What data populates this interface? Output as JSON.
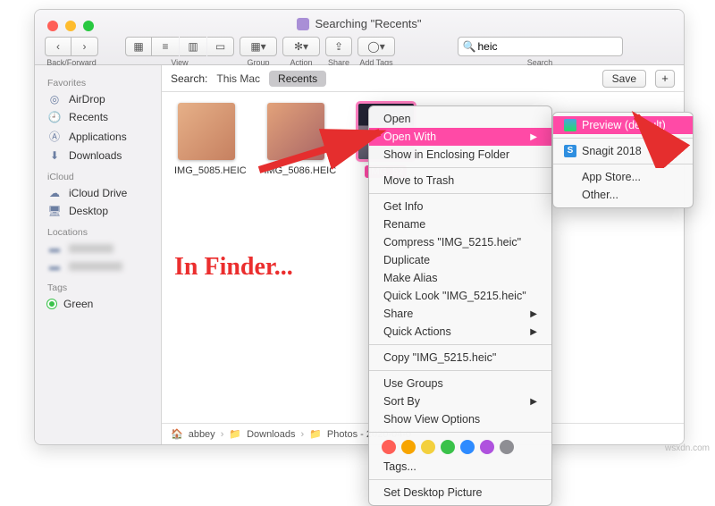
{
  "window": {
    "title": "Searching \"Recents\"",
    "toolbar": {
      "back_forward": "Back/Forward",
      "view": "View",
      "group": "Group",
      "action": "Action",
      "share": "Share",
      "add_tags": "Add Tags",
      "search_label": "Search"
    },
    "search_value": "heic"
  },
  "sidebar": {
    "sections": [
      {
        "title": "Favorites",
        "items": [
          {
            "icon": "airdrop",
            "label": "AirDrop"
          },
          {
            "icon": "clock",
            "label": "Recents"
          },
          {
            "icon": "apps",
            "label": "Applications"
          },
          {
            "icon": "download",
            "label": "Downloads"
          }
        ]
      },
      {
        "title": "iCloud",
        "items": [
          {
            "icon": "cloud",
            "label": "iCloud Drive"
          },
          {
            "icon": "desktop",
            "label": "Desktop"
          }
        ]
      },
      {
        "title": "Locations",
        "items": [
          {
            "icon": "blur",
            "label": ""
          },
          {
            "icon": "blur",
            "label": ""
          }
        ]
      },
      {
        "title": "Tags",
        "items": [
          {
            "icon": "tag-green",
            "label": "Green"
          }
        ]
      }
    ]
  },
  "search_scope": {
    "label": "Search:",
    "this_mac": "This Mac",
    "recents": "Recents",
    "save": "Save"
  },
  "files": [
    {
      "name": "IMG_5085.HEIC"
    },
    {
      "name": "IMG_5086.HEIC"
    },
    {
      "name": "IMG_5215.heic",
      "selected": true,
      "truncated": "IMG_52"
    }
  ],
  "pathbar": [
    "abbey",
    "Downloads",
    "Photos - 2020-04-0"
  ],
  "annotation": "In Finder...",
  "context_menu": {
    "open": "Open",
    "open_with": "Open With",
    "show_enclosing": "Show in Enclosing Folder",
    "move_to_trash": "Move to Trash",
    "get_info": "Get Info",
    "rename": "Rename",
    "compress": "Compress \"IMG_5215.heic\"",
    "duplicate": "Duplicate",
    "make_alias": "Make Alias",
    "quick_look": "Quick Look \"IMG_5215.heic\"",
    "share": "Share",
    "quick_actions": "Quick Actions",
    "copy": "Copy \"IMG_5215.heic\"",
    "use_groups": "Use Groups",
    "sort_by": "Sort By",
    "show_view_options": "Show View Options",
    "tags_label": "Tags...",
    "tag_colors": [
      "#ff5f57",
      "#f7a500",
      "#f3d03e",
      "#3ac24a",
      "#2e8bff",
      "#af52de",
      "#8e8e93"
    ],
    "set_desktop": "Set Desktop Picture"
  },
  "submenu": {
    "preview": "Preview (default)",
    "snagit": "Snagit 2018",
    "app_store": "App Store...",
    "other": "Other..."
  },
  "watermark": "wsxdn.com"
}
